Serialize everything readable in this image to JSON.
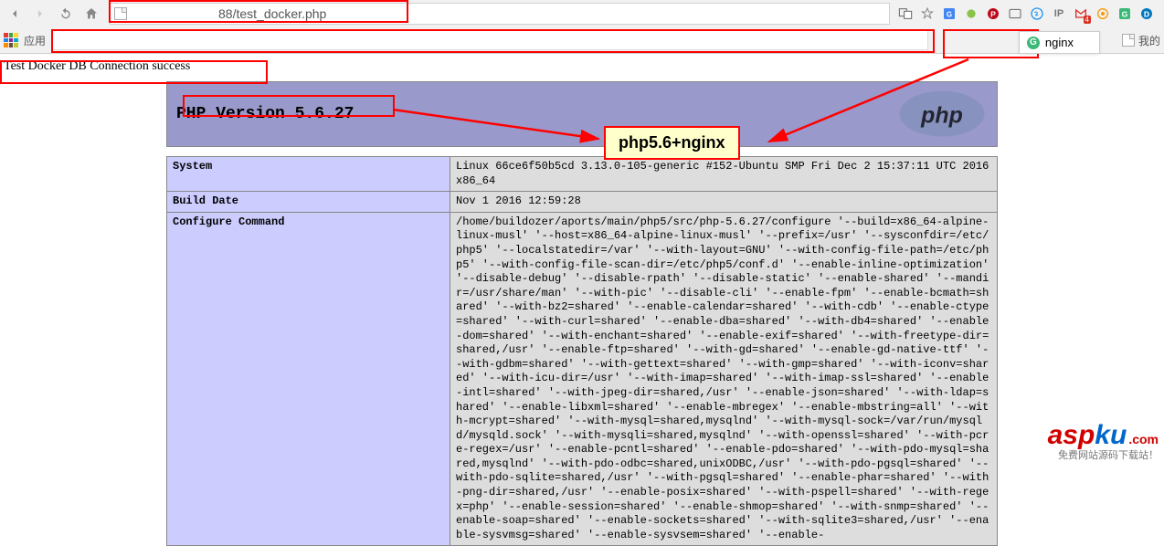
{
  "browser": {
    "url_suffix": "88/test_docker.php",
    "apps_label": "应用",
    "other_bookmarks_label": "我的",
    "tooltip_text": "nginx",
    "gmail_badge": "4"
  },
  "page": {
    "db_message": "Test Docker DB Connection success"
  },
  "phpinfo": {
    "version_label": "PHP Version 5.6.27",
    "rows": [
      {
        "key": "System",
        "val": "Linux 66ce6f50b5cd 3.13.0-105-generic #152-Ubuntu SMP Fri Dec 2 15:37:11 UTC 2016 x86_64"
      },
      {
        "key": "Build Date",
        "val": "Nov 1 2016 12:59:28"
      },
      {
        "key": "Configure Command",
        "val": "/home/buildozer/aports/main/php5/src/php-5.6.27/configure '--build=x86_64-alpine-linux-musl' '--host=x86_64-alpine-linux-musl' '--prefix=/usr' '--sysconfdir=/etc/php5' '--localstatedir=/var' '--with-layout=GNU' '--with-config-file-path=/etc/php5' '--with-config-file-scan-dir=/etc/php5/conf.d' '--enable-inline-optimization' '--disable-debug' '--disable-rpath' '--disable-static' '--enable-shared' '--mandir=/usr/share/man' '--with-pic' '--disable-cli' '--enable-fpm' '--enable-bcmath=shared' '--with-bz2=shared' '--enable-calendar=shared' '--with-cdb' '--enable-ctype=shared' '--with-curl=shared' '--enable-dba=shared' '--with-db4=shared' '--enable-dom=shared' '--with-enchant=shared' '--enable-exif=shared' '--with-freetype-dir=shared,/usr' '--enable-ftp=shared' '--with-gd=shared' '--enable-gd-native-ttf' '--with-gdbm=shared' '--with-gettext=shared' '--with-gmp=shared' '--with-iconv=shared' '--with-icu-dir=/usr' '--with-imap=shared' '--with-imap-ssl=shared' '--enable-intl=shared' '--with-jpeg-dir=shared,/usr' '--enable-json=shared' '--with-ldap=shared' '--enable-libxml=shared' '--enable-mbregex' '--enable-mbstring=all' '--with-mcrypt=shared' '--with-mysql=shared,mysqlnd' '--with-mysql-sock=/var/run/mysqld/mysqld.sock' '--with-mysqli=shared,mysqlnd' '--with-openssl=shared' '--with-pcre-regex=/usr' '--enable-pcntl=shared' '--enable-pdo=shared' '--with-pdo-mysql=shared,mysqlnd' '--with-pdo-odbc=shared,unixODBC,/usr' '--with-pdo-pgsql=shared' '--with-pdo-sqlite=shared,/usr' '--with-pgsql=shared' '--enable-phar=shared' '--with-png-dir=shared,/usr' '--enable-posix=shared' '--with-pspell=shared' '--with-regex=php' '--enable-session=shared' '--enable-shmop=shared' '--with-snmp=shared' '--enable-soap=shared' '--enable-sockets=shared' '--with-sqlite3=shared,/usr' '--enable-sysvmsg=shared' '--enable-sysvsem=shared' '--enable-"
      }
    ]
  },
  "annotation": {
    "center_label": "php5.6+nginx"
  },
  "watermark": {
    "asp": "asp",
    "ku": "ku",
    "com": ".com",
    "sub": "免费网站源码下载站！"
  }
}
